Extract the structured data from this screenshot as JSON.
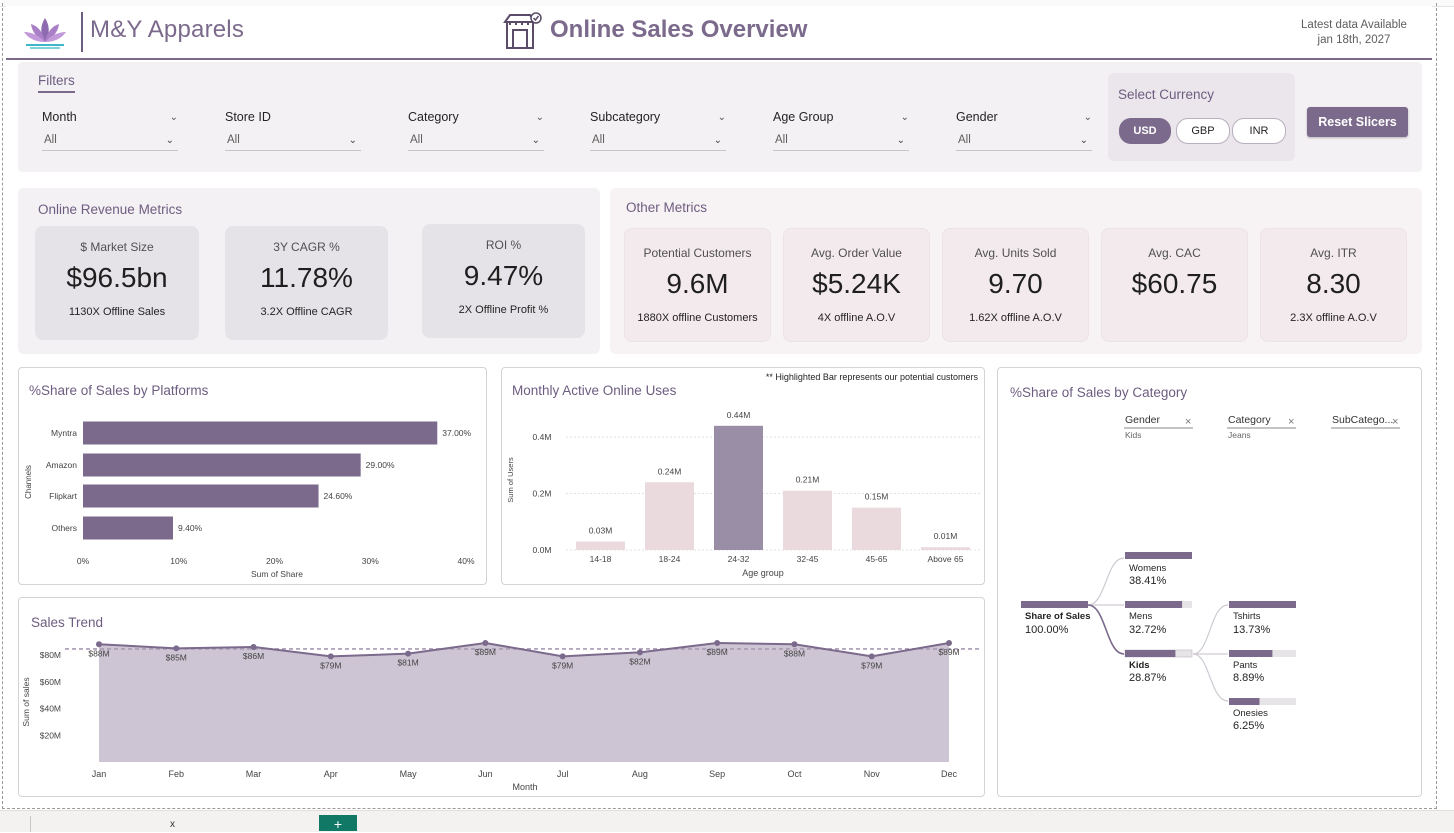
{
  "header": {
    "brand": "M&Y Apparels",
    "title": "Online Sales Overview",
    "latest_line1": "Latest data Available",
    "latest_line2": "jan 18th, 2027"
  },
  "filters": {
    "title": "Filters",
    "slicers": [
      {
        "label": "Month",
        "value": "All"
      },
      {
        "label": "Store ID",
        "value": "All"
      },
      {
        "label": "Category",
        "value": "All"
      },
      {
        "label": "Subcategory",
        "value": "All"
      },
      {
        "label": "Age Group",
        "value": "All"
      },
      {
        "label": "Gender",
        "value": "All"
      }
    ],
    "currency_title": "Select Currency",
    "currencies": [
      "USD",
      "GBP",
      "INR"
    ],
    "active_currency": "USD",
    "reset_label": "Reset Slicers"
  },
  "revenue": {
    "title": "Online Revenue Metrics",
    "kpis": [
      {
        "label": "$ Market Size",
        "value": "$96.5bn",
        "sub": "1130X Offline Sales"
      },
      {
        "label": "3Y CAGR %",
        "value": "11.78%",
        "sub": "3.2X Offline CAGR"
      },
      {
        "label": "ROI %",
        "value": "9.47%",
        "sub": "2X Offline Profit %"
      }
    ]
  },
  "other": {
    "title": "Other Metrics",
    "kpis": [
      {
        "label": "Potential Customers",
        "value": "9.6M",
        "sub": "1880X offline Customers"
      },
      {
        "label": "Avg. Order Value",
        "value": "$5.24K",
        "sub": "4X offline A.O.V"
      },
      {
        "label": "Avg. Units Sold",
        "value": "9.70",
        "sub": "1.62X offline A.O.V"
      },
      {
        "label": "Avg. CAC",
        "value": "$60.75",
        "sub": ""
      },
      {
        "label": "Avg. ITR",
        "value": "8.30",
        "sub": "2.3X offline A.O.V"
      }
    ]
  },
  "platforms": {
    "title": "%Share of Sales by Platforms",
    "ylabel": "Channels",
    "xlabel": "Sum of Share",
    "ticks": [
      "0%",
      "10%",
      "20%",
      "30%",
      "40%"
    ],
    "chart_data": {
      "type": "bar",
      "categories": [
        "Myntra",
        "Amazon",
        "Flipkart",
        "Others"
      ],
      "values": [
        37.0,
        29.0,
        24.6,
        9.4
      ],
      "labels": [
        "37.00%",
        "29.00%",
        "24.60%",
        "9.40%"
      ],
      "xlim": [
        0,
        40
      ]
    }
  },
  "mau": {
    "title": "Monthly Active Online Uses",
    "note": "** Highlighted Bar represents our potential customers",
    "ylabel": "Sum of Users",
    "xlabel": "Age group",
    "yticks": [
      "0.0M",
      "0.2M",
      "0.4M"
    ],
    "chart_data": {
      "type": "bar",
      "categories": [
        "14-18",
        "18-24",
        "24-32",
        "32-45",
        "45-65",
        "Above 65"
      ],
      "values": [
        0.03,
        0.24,
        0.44,
        0.21,
        0.15,
        0.01
      ],
      "labels": [
        "0.03M",
        "0.24M",
        "0.44M",
        "0.21M",
        "0.15M",
        "0.01M"
      ],
      "highlight": "24-32",
      "ylim": [
        0,
        0.45
      ]
    }
  },
  "trend": {
    "title": "Sales Trend",
    "ylabel": "Sum of sales",
    "xlabel": "Month",
    "yticks": [
      "$20M",
      "$40M",
      "$60M",
      "$80M"
    ],
    "chart_data": {
      "type": "area",
      "categories": [
        "Jan",
        "Feb",
        "Mar",
        "Apr",
        "May",
        "Jun",
        "Jul",
        "Aug",
        "Sep",
        "Oct",
        "Nov",
        "Dec"
      ],
      "values": [
        88,
        85,
        86,
        79,
        81,
        89,
        79,
        82,
        89,
        88,
        79,
        89
      ],
      "labels": [
        "$88M",
        "$85M",
        "$86M",
        "$79M",
        "$81M",
        "$89M",
        "$79M",
        "$82M",
        "$89M",
        "$88M",
        "$79M",
        "$89M"
      ],
      "ylim": [
        0,
        85
      ]
    }
  },
  "category": {
    "title": "%Share of Sales by Category",
    "levels": [
      {
        "name": "Gender",
        "value": "Kids"
      },
      {
        "name": "Category",
        "value": "Jeans"
      },
      {
        "name": "SubCatego...",
        "value": ""
      }
    ],
    "root": {
      "label": "Share of Sales",
      "value": "100.00%"
    },
    "gender": [
      {
        "label": "Womens",
        "value": "38.41%",
        "share": 38.41
      },
      {
        "label": "Mens",
        "value": "32.72%",
        "share": 32.72
      },
      {
        "label": "Kids",
        "value": "28.87%",
        "share": 28.87
      }
    ],
    "kids": [
      {
        "label": "Tshirts",
        "value": "13.73%",
        "share": 13.73
      },
      {
        "label": "Pants",
        "value": "8.89%",
        "share": 8.89
      },
      {
        "label": "Onesies",
        "value": "6.25%",
        "share": 6.25
      }
    ]
  },
  "tabs": {
    "add": "+"
  }
}
